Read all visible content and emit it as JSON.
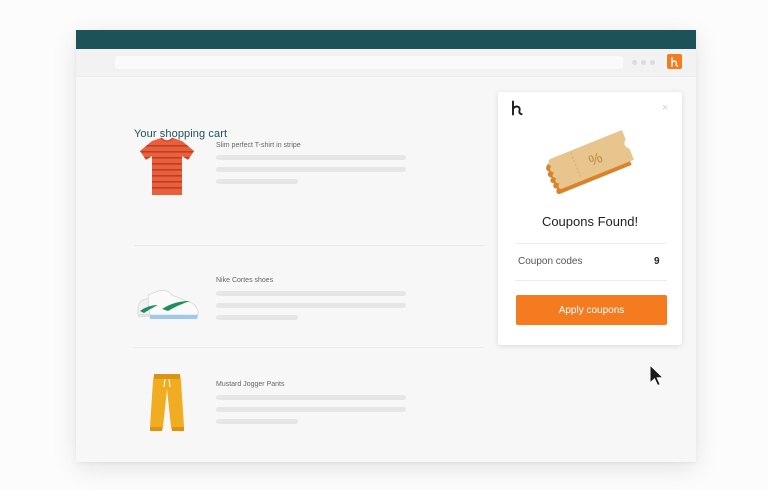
{
  "cart": {
    "title": "Your shopping cart",
    "items": [
      {
        "name": "Slim perfect T-shirt in stripe",
        "icon": "striped-tshirt-icon"
      },
      {
        "name": "Nike Cortes shoes",
        "icon": "sneaker-icon"
      },
      {
        "name": "Mustard Jogger Pants",
        "icon": "jogger-pants-icon"
      }
    ]
  },
  "popup": {
    "logo_glyph": "h",
    "close_glyph": "×",
    "heading": "Coupons Found!",
    "code_label": "Coupon codes",
    "code_count": "9",
    "apply_label": "Apply coupons",
    "coupon_glyph": "%"
  },
  "colors": {
    "accent": "#f47b20",
    "titlebar": "#1d5259",
    "heading": "#1d5259"
  }
}
